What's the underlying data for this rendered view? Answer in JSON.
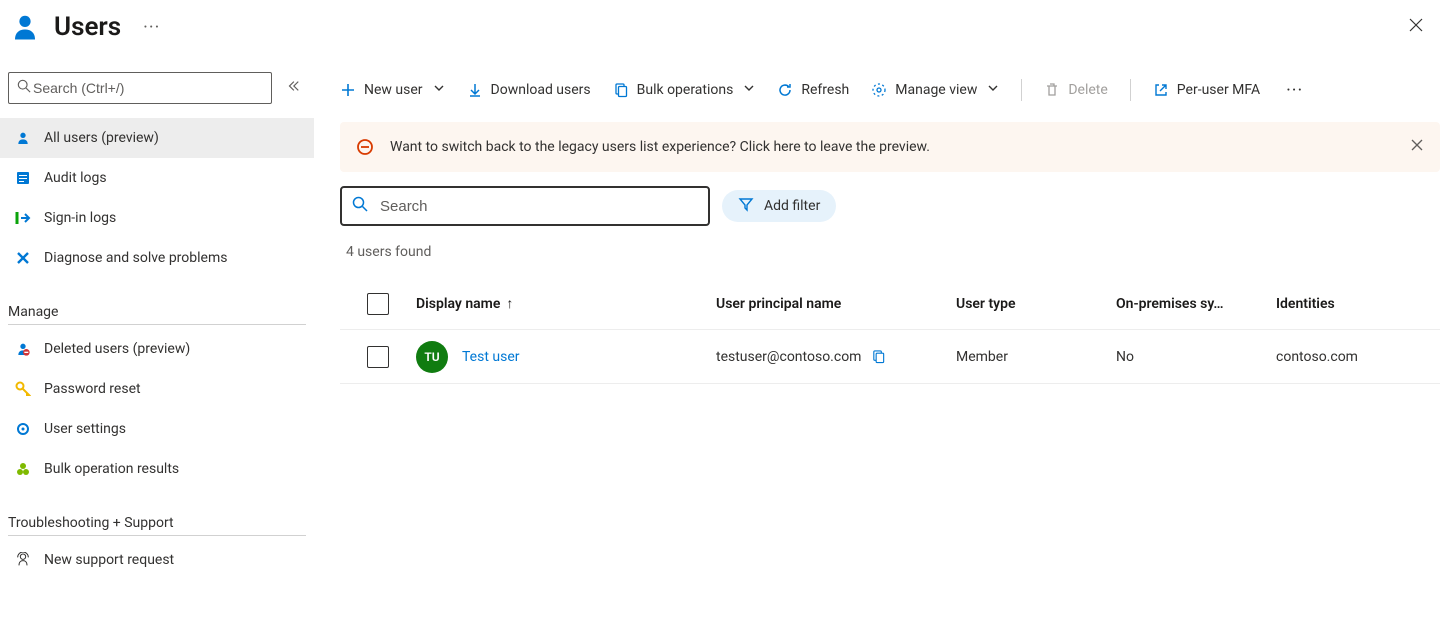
{
  "header": {
    "title": "Users"
  },
  "sidebar": {
    "search_placeholder": "Search (Ctrl+/)",
    "items": [
      {
        "id": "all-users",
        "label": "All users (preview)"
      },
      {
        "id": "audit-logs",
        "label": "Audit logs"
      },
      {
        "id": "signin-logs",
        "label": "Sign-in logs"
      },
      {
        "id": "diagnose",
        "label": "Diagnose and solve problems"
      }
    ],
    "manage_title": "Manage",
    "manage_items": [
      {
        "id": "deleted-users",
        "label": "Deleted users (preview)"
      },
      {
        "id": "password-reset",
        "label": "Password reset"
      },
      {
        "id": "user-settings",
        "label": "User settings"
      },
      {
        "id": "bulk-results",
        "label": "Bulk operation results"
      }
    ],
    "troubleshoot_title": "Troubleshooting + Support",
    "troubleshoot_items": [
      {
        "id": "new-support",
        "label": "New support request"
      }
    ]
  },
  "toolbar": {
    "new_user": "New user",
    "download_users": "Download users",
    "bulk_ops": "Bulk operations",
    "refresh": "Refresh",
    "manage_view": "Manage view",
    "delete": "Delete",
    "per_user_mfa": "Per-user MFA"
  },
  "banner": {
    "text": "Want to switch back to the legacy users list experience? Click here to leave the preview."
  },
  "filters": {
    "search_placeholder": "Search",
    "add_filter": "Add filter"
  },
  "results": {
    "count_text": "4 users found"
  },
  "table": {
    "columns": {
      "display_name": "Display name",
      "upn": "User principal name",
      "user_type": "User type",
      "onprem": "On-premises sy…",
      "identities": "Identities"
    },
    "rows": [
      {
        "initials": "TU",
        "display_name": "Test user",
        "upn": "testuser@contoso.com",
        "user_type": "Member",
        "onprem": "No",
        "identities": "contoso.com",
        "avatar_color": "#19a319"
      }
    ]
  },
  "colors": {
    "accent": "#0078d4",
    "banner_bg": "#fdf6f0",
    "banner_icon": "#d83b01"
  }
}
